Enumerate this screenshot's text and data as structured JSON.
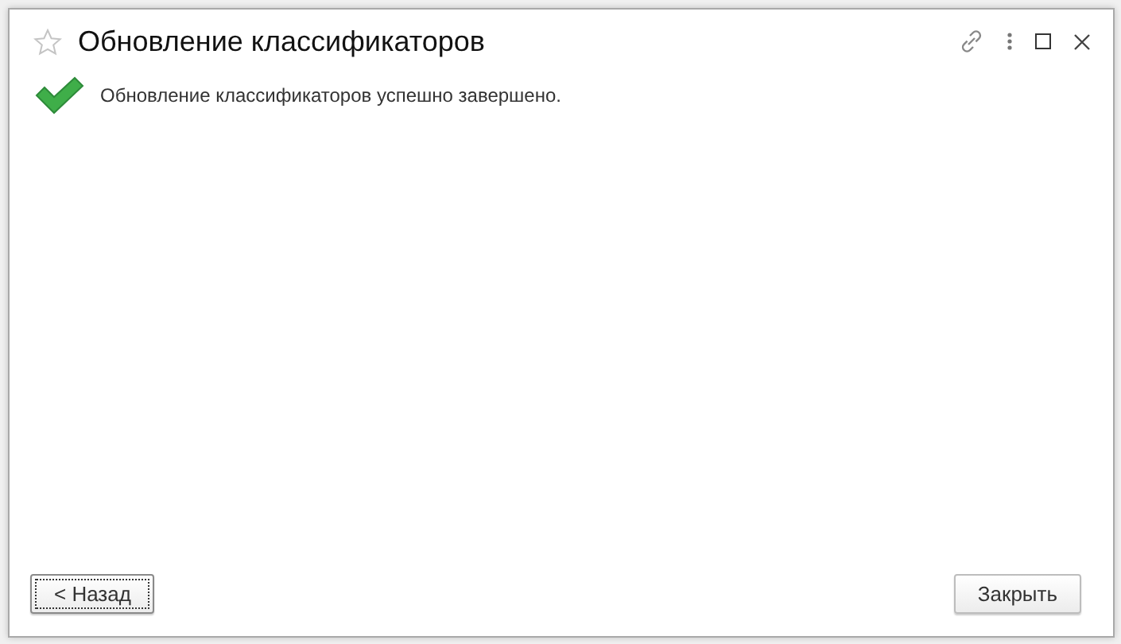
{
  "window": {
    "title": "Обновление классификаторов"
  },
  "message": {
    "text": "Обновление классификаторов успешно завершено."
  },
  "buttons": [
    {
      "label": "< Назад",
      "focused": true
    },
    {
      "label": "Закрыть",
      "focused": false
    }
  ]
}
